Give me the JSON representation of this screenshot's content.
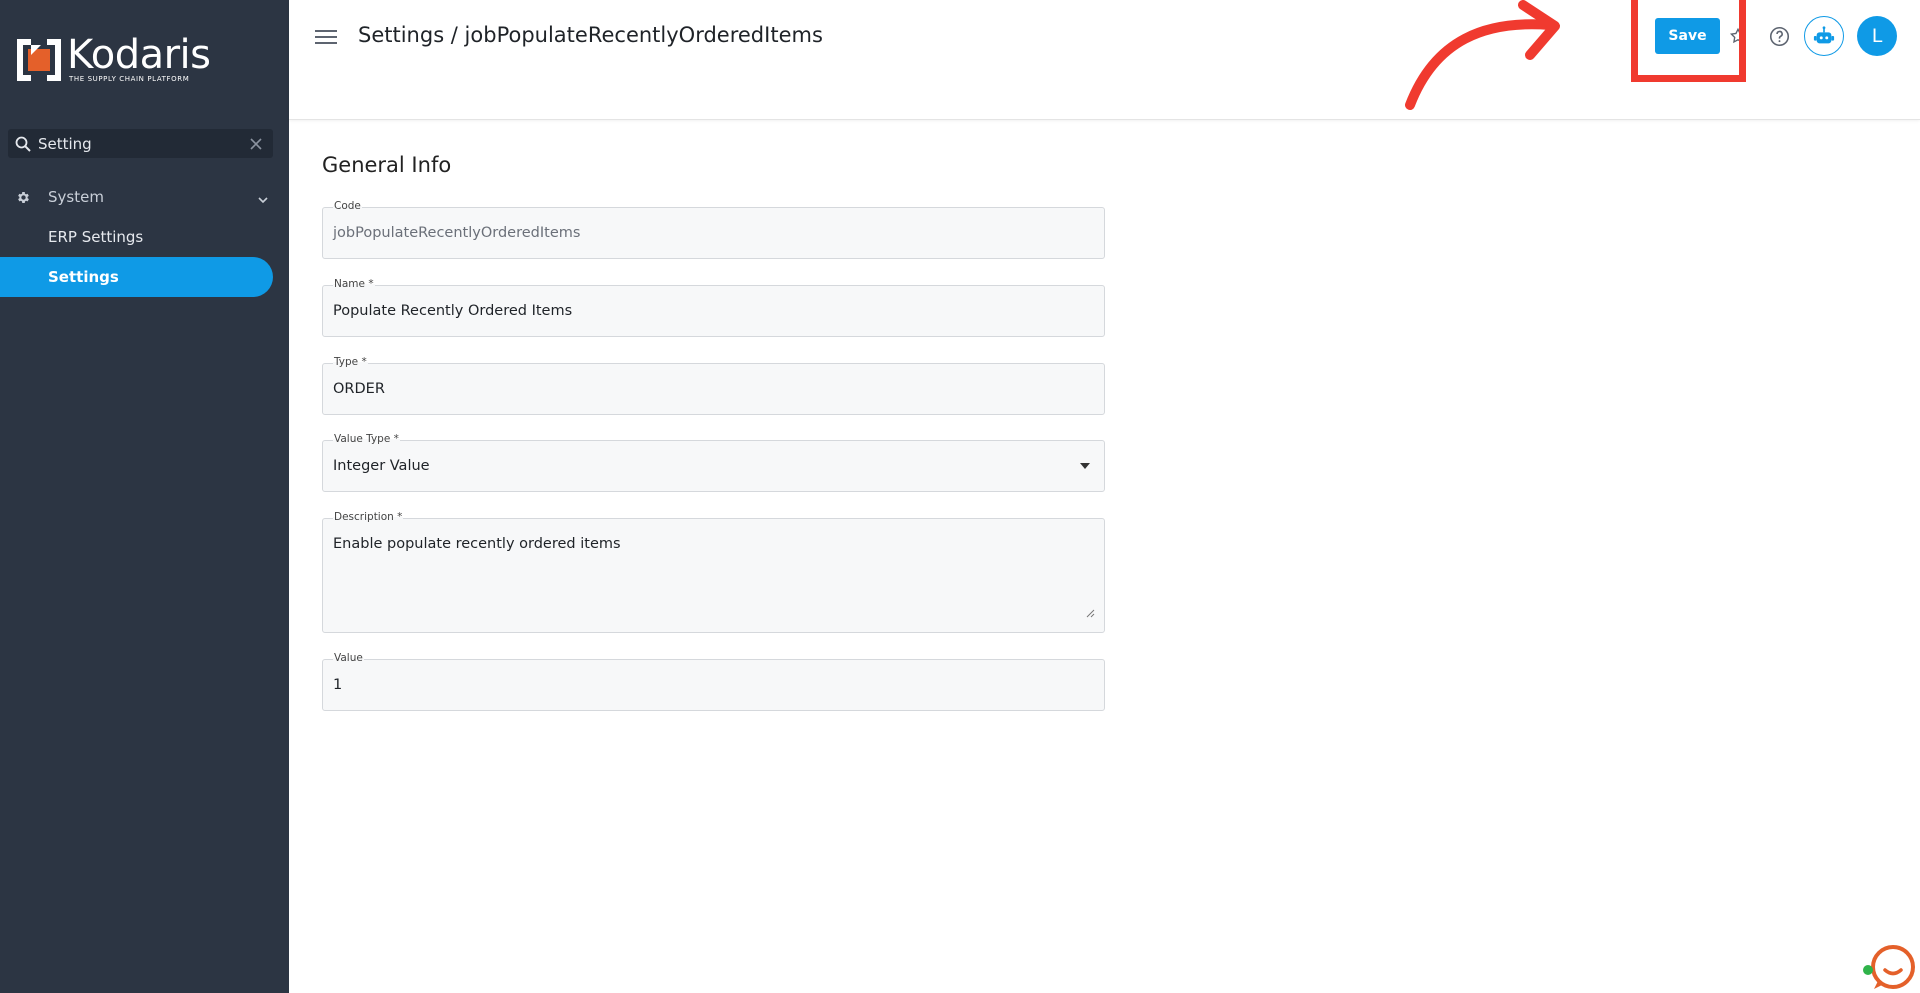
{
  "sidebar": {
    "logo": {
      "word": "Kodaris",
      "tagline": "THE SUPPLY CHAIN PLATFORM",
      "accent": "#e4602a"
    },
    "search": {
      "value": "Setting"
    },
    "group": {
      "label": "System"
    },
    "items": [
      {
        "label": "ERP Settings"
      },
      {
        "label": "Settings",
        "active": true
      }
    ]
  },
  "header": {
    "title": "Settings / jobPopulateRecentlyOrderedItems",
    "save_label": "Save",
    "avatar_initial": "L"
  },
  "main": {
    "section_title": "General Info",
    "fields": {
      "code": {
        "label": "Code",
        "value": "jobPopulateRecentlyOrderedItems"
      },
      "name": {
        "label": "Name *",
        "value": "Populate Recently Ordered Items"
      },
      "type": {
        "label": "Type *",
        "value": "ORDER"
      },
      "value_type": {
        "label": "Value Type *",
        "value": "Integer Value"
      },
      "description": {
        "label": "Description *",
        "value": "Enable populate recently ordered items"
      },
      "value": {
        "label": "Value",
        "value": "1"
      }
    }
  },
  "colors": {
    "sidebar_bg": "#2c3543",
    "accent": "#0f9ae6",
    "annotation": "#f03a2f",
    "chat": "#e4602a"
  }
}
